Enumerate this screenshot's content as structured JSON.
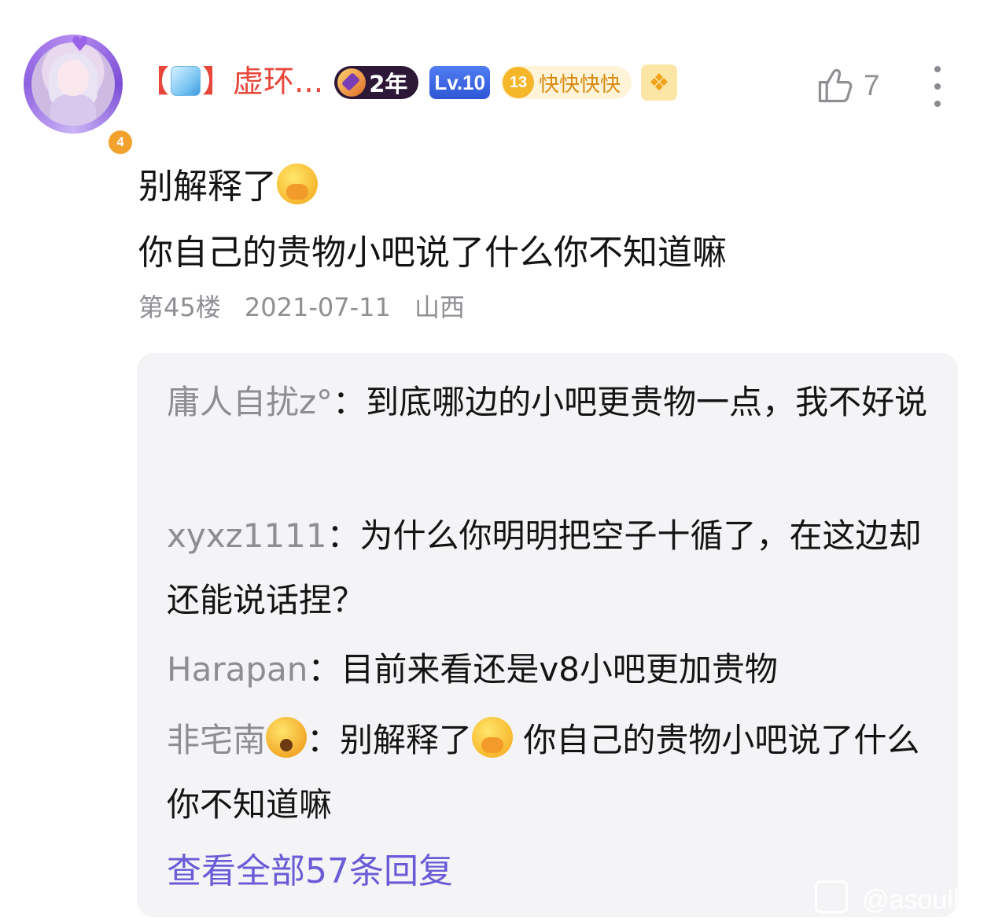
{
  "post": {
    "username_prefix": "【",
    "username_suffix": "】虚环...",
    "year_badge": "2年",
    "level_badge": "Lv.10",
    "member_number": "13",
    "member_label": "快快快快",
    "avatar_level": "4",
    "like_count": "7",
    "content_line1": "别解释了",
    "content_line2": "你自己的贵物小吧说了什么你不知道嘛",
    "floor": "第45楼",
    "date": "2021-07-11",
    "location": "山西"
  },
  "replies": [
    {
      "author": "庸人自扰z°",
      "separator": "：",
      "text": "到底哪边的小吧更贵物一点，我不好说"
    },
    {
      "author": "xyxz1111",
      "separator": "：",
      "text": "为什么你明明把空子十循了，在这边却还能说话捏？"
    },
    {
      "author": "Harapan",
      "separator": "：",
      "text": "目前来看还是v8小吧更加贵物"
    },
    {
      "author": "非宅南",
      "separator": "：",
      "text_a": "别解释了",
      "text_b": " 你自己的贵物小吧说了什么你不知道嘛"
    }
  ],
  "view_all_label": "查看全部57条回复",
  "watermark": "@asoul吧",
  "colors": {
    "username": "#e8463a",
    "link": "#6b5bd6",
    "meta": "#8f8f94",
    "reply_bg": "#f4f4f7"
  },
  "icons": [
    "ice-cube-icon",
    "gem-icon",
    "shield-badge-icon",
    "thumbs-up-icon",
    "more-vertical-icon",
    "hand-over-mouth-emoji",
    "screaming-face-emoji"
  ]
}
